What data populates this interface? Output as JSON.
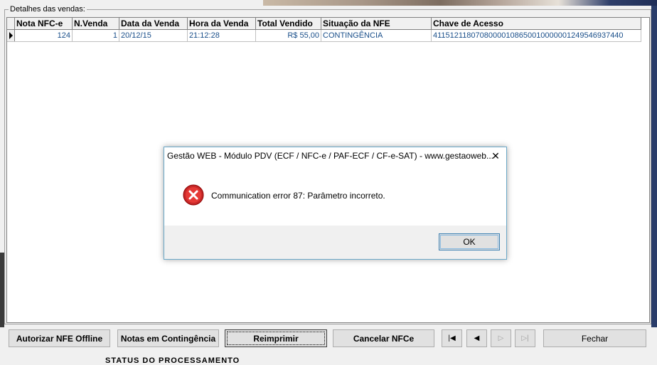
{
  "group": {
    "caption": "Detalhes das vendas:"
  },
  "table": {
    "columns": [
      "Nota NFC-e",
      "N.Venda",
      "Data da Venda",
      "Hora da Venda",
      "Total Vendido",
      "Situação da NFE",
      "Chave de Acesso"
    ],
    "rows": [
      [
        "124",
        "1",
        "20/12/15",
        "21:12:28",
        "R$ 55,00",
        "CONTINGÊNCIA",
        "41151211807080000108650010000001249546937440"
      ]
    ]
  },
  "toolbar": {
    "authorize_label": "Autorizar NFE Offline",
    "contingency_label": "Notas em Contingência",
    "reprint_label": "Reimprimir",
    "cancel_label": "Cancelar NFCe",
    "close_label": "Fechar",
    "nav": {
      "first": "first-record-icon",
      "prior": "prior-record-icon",
      "next": "next-record-icon",
      "last": "last-record-icon"
    }
  },
  "status": {
    "label": "STATUS DO PROCESSAMENTO"
  },
  "dialog": {
    "title": "Gestão WEB - Módulo PDV (ECF / NFC-e / PAF-ECF / CF-e-SAT) - www.gestaoweb...",
    "message": "Communication error 87: Parâmetro incorreto.",
    "ok_label": "OK",
    "icon": "error-icon",
    "icon_color": "#d32f2f"
  }
}
